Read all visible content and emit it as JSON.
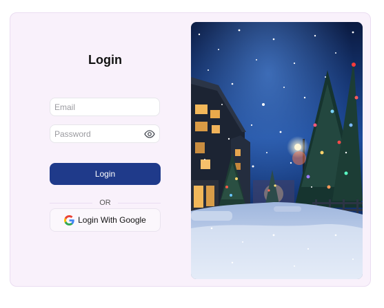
{
  "form": {
    "title": "Login",
    "email_placeholder": "Email",
    "password_placeholder": "Password",
    "login_label": "Login",
    "divider_text": "OR",
    "google_label": "Login With Google"
  },
  "icons": {
    "password_toggle": "eye-icon",
    "google": "google-logo-icon"
  },
  "colors": {
    "primary": "#1f3a8a",
    "card_background": "#f9f1fb",
    "card_border": "#eadcf1"
  },
  "image": {
    "subject": "snowy village street at night with decorated Christmas trees"
  }
}
